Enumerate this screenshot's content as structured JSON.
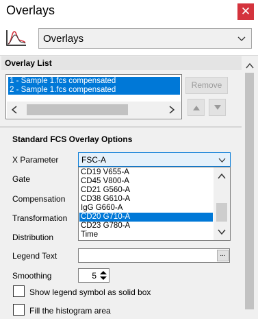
{
  "window": {
    "title": "Overlays",
    "close_glyph": "✕"
  },
  "header": {
    "selected": "Overlays",
    "icon": "histogram-overlay-icon"
  },
  "overlay_list": {
    "heading": "Overlay List",
    "items": [
      "1 - Sample 1.fcs compensated",
      "2 - Sample 1.fcs compensated"
    ],
    "remove_label": "Remove"
  },
  "options": {
    "heading": "Standard FCS Overlay Options",
    "x_parameter_label": "X Parameter",
    "x_parameter_value": "FSC-A",
    "dropdown_options": [
      "CD19 V655-A",
      "CD45 V800-A",
      "CD21 G560-A",
      "CD38 G610-A",
      "IgG G660-A",
      "CD20 G710-A",
      "CD23 G780-A",
      "Time"
    ],
    "dropdown_selected": "CD20 G710-A",
    "gate_label": "Gate",
    "compensation_label": "Compensation",
    "transformation_label": "Transformation",
    "distribution_label": "Distribution",
    "legend_text_label": "Legend Text",
    "legend_text_value": "",
    "browse_glyph": "...",
    "smoothing_label": "Smoothing",
    "smoothing_value": "5",
    "show_legend_label": "Show legend symbol as solid box",
    "fill_histogram_label": "Fill the histogram area"
  },
  "colors": {
    "accent": "#0078d7",
    "close": "#d4333d"
  }
}
